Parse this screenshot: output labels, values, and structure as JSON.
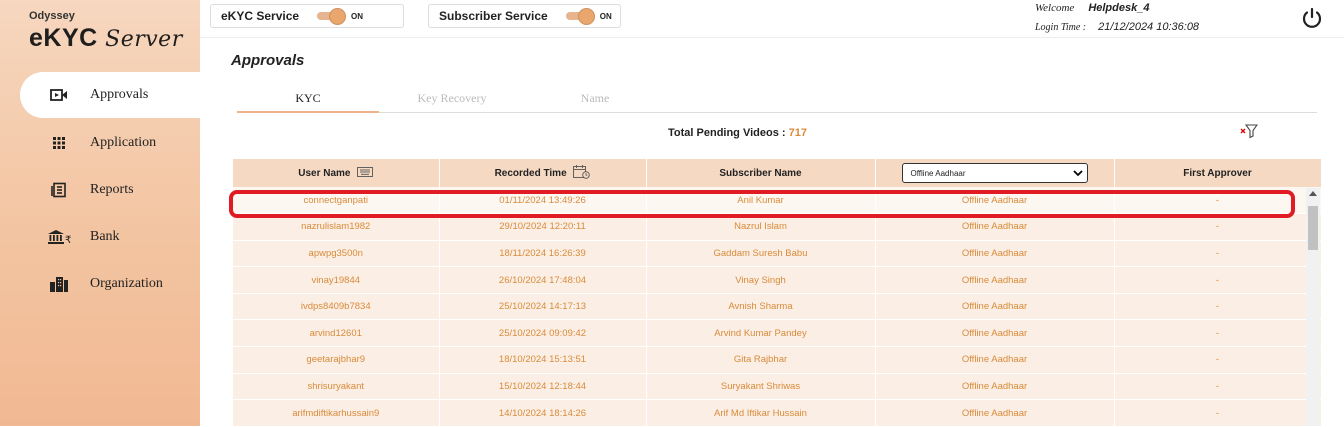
{
  "brand": {
    "small": "Odyssey",
    "main": "eKYC",
    "server": "Server"
  },
  "sidebar": {
    "items": [
      {
        "label": "Approvals",
        "icon": "video-icon",
        "active": true
      },
      {
        "label": "Application",
        "icon": "grid-icon"
      },
      {
        "label": "Reports",
        "icon": "report-icon"
      },
      {
        "label": "Bank",
        "icon": "bank-icon"
      },
      {
        "label": "Organization",
        "icon": "building-icon"
      }
    ]
  },
  "topbar": {
    "ekyc_service": {
      "label": "eKYC Service",
      "state": "ON"
    },
    "subscriber_service": {
      "label": "Subscriber Service",
      "state": "ON"
    },
    "welcome_label": "Welcome",
    "username": "Helpdesk_4",
    "login_label": "Login Time :",
    "login_time": "21/12/2024 10:36:08"
  },
  "page": {
    "title": "Approvals",
    "tabs": [
      {
        "label": "KYC",
        "active": true
      },
      {
        "label": "Key Recovery"
      },
      {
        "label": "Name"
      }
    ],
    "pending_label": "Total Pending Videos :",
    "pending_count": "717"
  },
  "table": {
    "headers": [
      "User Name",
      "Recorded Time",
      "Subscriber Name",
      "Offline Aadhaar",
      "First Approver"
    ],
    "rows": [
      [
        "connectganpati",
        "01/11/2024 13:49:26",
        "Anil Kumar",
        "Offline Aadhaar",
        "-"
      ],
      [
        "nazrulislam1982",
        "29/10/2024 12:20:11",
        "Nazrul Islam",
        "Offline Aadhaar",
        "-"
      ],
      [
        "apwpg3500n",
        "18/11/2024 16:26:39",
        "Gaddam Suresh Babu",
        "Offline Aadhaar",
        "-"
      ],
      [
        "vinay19844",
        "26/10/2024 17:48:04",
        "Vinay Singh",
        "Offline Aadhaar",
        "-"
      ],
      [
        "ivdps8409b7834",
        "25/10/2024 14:17:13",
        "Avnish Sharma",
        "Offline Aadhaar",
        "-"
      ],
      [
        "arvind12601",
        "25/10/2024 09:09:42",
        "Arvind Kumar Pandey",
        "Offline Aadhaar",
        "-"
      ],
      [
        "geetarajbhar9",
        "18/10/2024 15:13:51",
        "Gita Rajbhar",
        "Offline Aadhaar",
        "-"
      ],
      [
        "shrisuryakant",
        "15/10/2024 12:18:44",
        "Suryakant Shriwas",
        "Offline Aadhaar",
        "-"
      ],
      [
        "arifmdiftikarhussain9",
        "14/10/2024 18:14:26",
        "Arif Md Iftikar Hussain",
        "Offline Aadhaar",
        "-"
      ]
    ]
  },
  "colors": {
    "accent": "#d98b3a",
    "sidebar": "#f3c4a1",
    "header_row": "#f6d9c3",
    "highlight": "#e01b24"
  }
}
